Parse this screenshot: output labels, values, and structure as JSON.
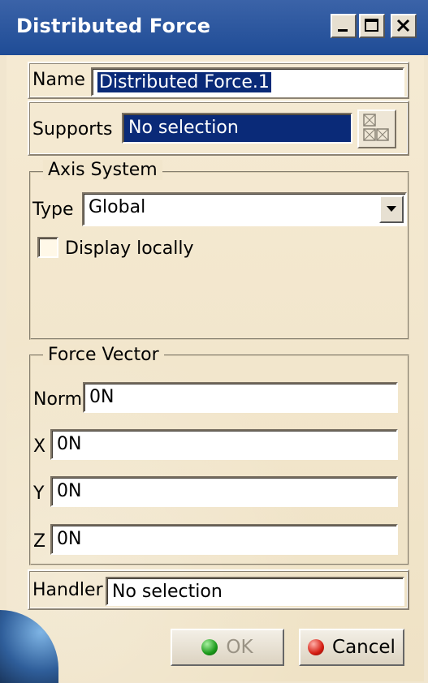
{
  "window": {
    "title": "Distributed Force",
    "controls": [
      "minimize-icon",
      "maximize-icon",
      "close-icon"
    ]
  },
  "name_row": {
    "label": "Name",
    "value": "Distributed Force.1"
  },
  "supports_row": {
    "label": "Supports",
    "value": "No selection",
    "button_icon": "selection-icon"
  },
  "axis_system": {
    "legend": "Axis System",
    "type_label": "Type",
    "type_value": "Global",
    "display_locally_label": "Display locally",
    "display_locally_checked": false
  },
  "force_vector": {
    "legend": "Force Vector",
    "norm_label": "Norm",
    "norm_value": "0N",
    "x_label": "X",
    "x_value": "0N",
    "y_label": "Y",
    "y_value": "0N",
    "z_label": "Z",
    "z_value": "0N"
  },
  "handler_row": {
    "label": "Handler",
    "value": "No selection"
  },
  "buttons": {
    "ok_label": "OK",
    "cancel_label": "Cancel"
  },
  "colors": {
    "title_bar": "#1f4c96",
    "selection": "#0a2a78",
    "background": "#f1e6cf"
  }
}
